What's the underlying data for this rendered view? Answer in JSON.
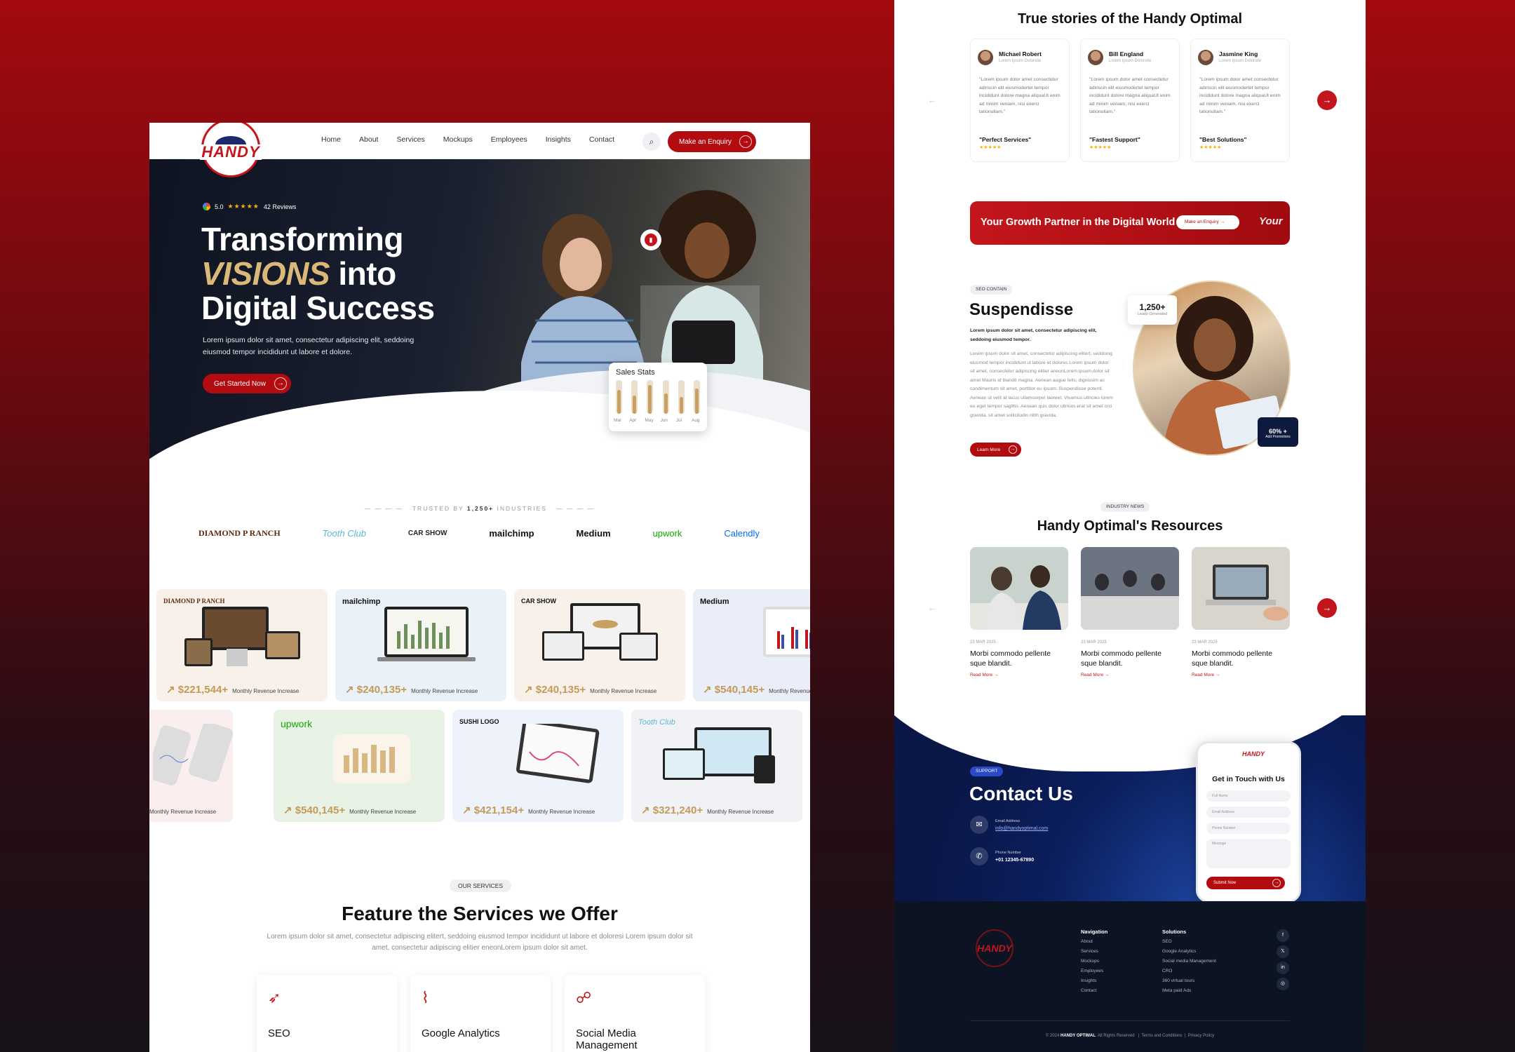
{
  "colors": {
    "brand_red": "#b20b10",
    "gold": "#c8a061",
    "navy": "#0b1f5e"
  },
  "left": {
    "logo_text": "HANDY",
    "nav": [
      "Home",
      "About",
      "Services",
      "Mockups",
      "Employees",
      "Insights",
      "Contact"
    ],
    "enquiry_label": "Make an Enquiry",
    "hero": {
      "rating": "5.0",
      "stars": "★★★★★",
      "reviews": "42 Reviews",
      "title_line1": "Transforming",
      "title_gold": "VISIONS",
      "title_into": " into",
      "title_line3": "Digital Success",
      "paragraph": "Lorem ipsum dolor sit amet, consectetur adipiscing elit, seddoing eiusmod tempor incididunt ut labore et dolore.",
      "cta": "Get Started Now",
      "stats_title": "Sales Stats",
      "stats_months": [
        "Mar",
        "Apr",
        "May",
        "Jun",
        "Jul",
        "Aug"
      ],
      "stats_levels": [
        0.7,
        0.55,
        0.85,
        0.6,
        0.5,
        0.75
      ]
    },
    "trusted_prefix": "TRUSTED BY ",
    "trusted_count": "1,250+",
    "trusted_suffix": " INDUSTRIES",
    "brands": [
      "DIAMOND P RANCH",
      "Tooth Club",
      "CAR SHOW",
      "mailchimp",
      "Medium",
      "upwork",
      "Calendly"
    ],
    "portfolio_row1": [
      {
        "brand": "DIAMOND P RANCH",
        "value": "$221,544+",
        "label": "Monthly Revenue Increase"
      },
      {
        "brand": "mailchimp",
        "value": "$240,135+",
        "label": "Monthly Revenue Increase"
      },
      {
        "brand": "CAR SHOW",
        "value": "$240,135+",
        "label": "Monthly Revenue Increase"
      },
      {
        "brand": "Medium",
        "value": "$540,145+",
        "label": "Monthly Revenue Increase"
      }
    ],
    "portfolio_row2": [
      {
        "brand": "",
        "value": "",
        "label": "Monthly Revenue Increase"
      },
      {
        "brand": "upwork",
        "value": "$540,145+",
        "label": "Monthly Revenue Increase"
      },
      {
        "brand": "SUSHI LOGO",
        "value": "$421,154+",
        "label": "Monthly Revenue Increase"
      },
      {
        "brand": "Tooth Club",
        "value": "$321,240+",
        "label": "Monthly Revenue Increase"
      }
    ],
    "services": {
      "tag": "OUR SERVICES",
      "title": "Feature the Services we Offer",
      "paragraph": "Lorem ipsum dolor sit amet, consectetur adipiscing elitert, seddoing eiusmod tempor incididunt ut labore et doloresi Lorem ipsum dolor sit amet, consectetur adipiscing elitier eneonLorem ipsum dolor sit amet.",
      "items": [
        "SEO",
        "Google Analytics",
        "Social Media Management"
      ]
    }
  },
  "right": {
    "testimonials_title": "True stories of the Handy Optimal",
    "testimonials": [
      {
        "name": "Michael Robert",
        "role": "Lorem Ipsum Dolorsite",
        "quote": "\"Lorem ipsum dolor amet consectetur adiriscin elit eiusmodertet tempor incididunt dolore magna aliquaUt enim ad minim veniam, nisi exerci tationullam.\"",
        "title": "\"Perfect Services\"",
        "stars": "★★★★★"
      },
      {
        "name": "Bill England",
        "role": "Lorem Ipsum Dolorsite",
        "quote": "\"Lorem ipsum dolor amet consectetur adiriscin elit eiusmodertet tempor incididunt dolore magna aliquaUt enim ad minim veniam, nisi exerci tationullam.\"",
        "title": "\"Fastest Support\"",
        "stars": "★★★★★"
      },
      {
        "name": "Jasmine King",
        "role": "Lorem Ipsum Dolorsite",
        "quote": "\"Lorem ipsum dolor amet consectetur adiriscin elit eiusmodertet tempor incididunt dolore magna aliquaUt enim ad minim veniam, nisi exerci tationullam.\"",
        "title": "\"Best Solutions\"",
        "stars": "★★★★★"
      }
    ],
    "banner_text": "Your Growth Partner in the Digital World",
    "banner_btn": "Make an Enquiry",
    "banner_text2": "Your",
    "seo": {
      "tag": "SEO CONTAIN",
      "title": "Suspendisse",
      "lead": "Lorem ipsum dolor sit amet, consectetur adipiscing elit, seddoing eiusmod tempor.",
      "body": "Lorem ipsum dolor sit amet, consectetur adipiscing elitert, seddoing eiusmod tempor incididunt ut labore et dolores Lorem ipsum dolor sit amet, consectetur adipiscing elitier aneonLorem ipsum dolor sit amet Mauris id blandit magna. Aenean augue felis, dignissim ac condimentum sit amet, porttitor eu ipsum. Suspendisse potenti. Aenean ut velit at lacus ullamcorper laoreet. Vivamus ultricies lorem eu eget tempor sagittis. Aenean quis dolor ultrices erat sit amet orci gravida, sit amet sollicitudin nibh gravida.",
      "cta": "Learn More",
      "leads_value": "1,250+",
      "leads_label": "Leads Generated",
      "promo_value": "60% +",
      "promo_label": "Add Promotions"
    },
    "resources": {
      "tag": "INDUSTRY NEWS",
      "title": "Handy Optimal's Resources",
      "items": [
        {
          "date": "23 MAR 2025",
          "title": "Morbi commodo pellente sque blandit.",
          "more": "Read More →"
        },
        {
          "date": "23 MAR 2025",
          "title": "Morbi commodo pellente sque blandit.",
          "more": "Read More →"
        },
        {
          "date": "23 MAR 2025",
          "title": "Morbi commodo pellente sque blandit.",
          "more": "Read More →"
        }
      ]
    },
    "contact": {
      "tag": "SUPPORT",
      "title": "Contact Us",
      "email_label": "Email Address",
      "email": "info@handyoptimal.com",
      "phone_label": "Phone Number",
      "phone": "+01 12345-67890",
      "form_title": "Get in Touch with Us",
      "fields": [
        "Full Name",
        "Email Address",
        "Phone Number",
        "Message"
      ],
      "submit": "Submit Now"
    },
    "footer": {
      "nav_title": "Navigation",
      "nav": [
        "About",
        "Services",
        "Mockups",
        "Employees",
        "Insights",
        "Contact"
      ],
      "sol_title": "Solutions",
      "sol": [
        "SEO",
        "Google Analytics",
        "Social media Management",
        "CRO",
        "360 virtual tours",
        "Meta paid Ads"
      ],
      "social": [
        "f",
        "𝕏",
        "in",
        "◎"
      ],
      "copyright_prefix": "© 2024 ",
      "copyright_brand": "HANDY OPTIMAL",
      "copyright_suffix": ". All Rights Reserved",
      "terms": "Terms and Conditions",
      "privacy": "Privacy Policy"
    }
  }
}
